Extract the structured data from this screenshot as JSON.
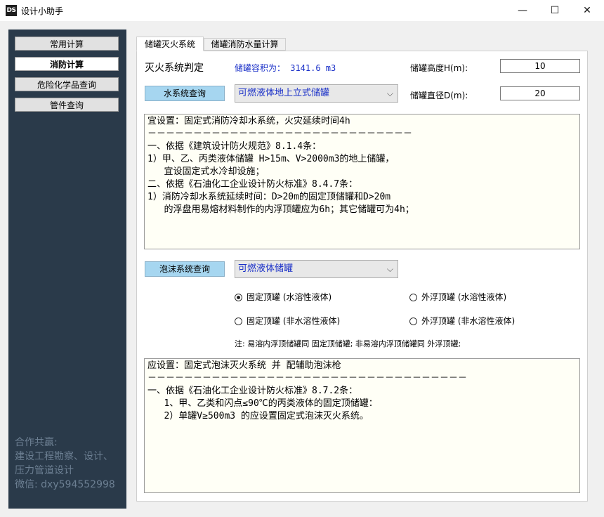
{
  "window": {
    "icon_text": "DS",
    "title": "设计小助手",
    "minimize": "—",
    "maximize": "☐",
    "close": "✕"
  },
  "sidebar": {
    "items": [
      {
        "label": "常用计算",
        "active": false
      },
      {
        "label": "消防计算",
        "active": true
      },
      {
        "label": "危险化学品查询",
        "active": false
      },
      {
        "label": "管件查询",
        "active": false
      }
    ],
    "note_lines": [
      "合作共赢:",
      "建设工程勘察、设计、",
      "压力管道设计",
      "微信: dxy594552998"
    ]
  },
  "tabs": [
    {
      "label": "储罐灭火系统",
      "active": true
    },
    {
      "label": "储罐消防水量计算",
      "active": false
    }
  ],
  "form": {
    "system_label": "灭火系统判定",
    "volume_text": "储罐容积为： 3141.6 m3",
    "height_label": "储罐高度H(m):",
    "height_value": "10",
    "diameter_label": "储罐直径D(m):",
    "diameter_value": "20",
    "water_button": "水系统查询",
    "water_select": "可燃液体地上立式储罐",
    "foam_button": "泡沫系统查询",
    "foam_select": "可燃液体储罐"
  },
  "water_result": "宜设置：固定式消防冷却水系统，火灾延续时间4h\n－－－－－－－－－－－－－－－－－－－－－－－－－－－－－\n一、依据《建筑设计防火规范》8.1.4条：\n1）甲、乙、丙类液体储罐 H>15m、V>2000m3的地上储罐，\n   宜设固定式水冷却设施；\n二、依据《石油化工企业设计防火标准》8.4.7条：\n1）消防冷却水系统延续时间：D>20m的固定顶储罐和D>20m\n   的浮盘用易熔材料制作的内浮顶罐应为6h；其它储罐可为4h；",
  "radios": [
    {
      "label": "固定顶罐 (水溶性液体)",
      "checked": true
    },
    {
      "label": "外浮顶罐 (水溶性液体)",
      "checked": false
    },
    {
      "label": "固定顶罐 (非水溶性液体)",
      "checked": false
    },
    {
      "label": "外浮顶罐 (非水溶性液体)",
      "checked": false
    }
  ],
  "foam_note": "注:  易溶内浮顶储罐同 固定顶储罐;    非易溶内浮顶储罐同 外浮顶罐;",
  "foam_result": "应设置：固定式泡沫灭火系统 并 配辅助泡沫枪\n－－－－－－－－－－－－－－－－－－－－－－－－－－－－－－－－－－－\n一、依据《石油化工企业设计防火标准》8.7.2条：\n   1、甲、乙类和闪点≤90℃的丙类液体的固定顶储罐：\n   2）单罐V≥500m3 的应设置固定式泡沫灭火系统。"
}
